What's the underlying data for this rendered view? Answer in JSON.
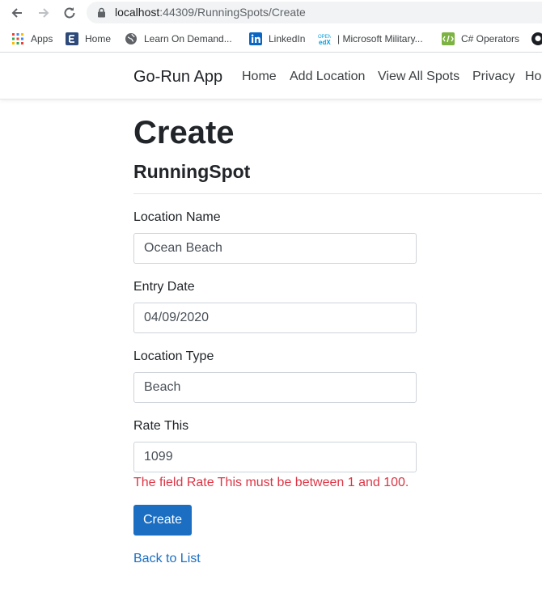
{
  "browser": {
    "url_host": "localhost",
    "url_rest": ":44309/RunningSpots/Create",
    "bookmarks": [
      {
        "label": "Apps",
        "icon": "apps-grid-icon"
      },
      {
        "label": "Home",
        "icon": "e-icon"
      },
      {
        "label": "Learn On Demand...",
        "icon": "globe-icon"
      },
      {
        "label": "LinkedIn",
        "icon": "linkedin-icon"
      },
      {
        "label": "| Microsoft Military...",
        "icon": "edx-icon"
      },
      {
        "label": "C# Operators",
        "icon": "code-icon"
      }
    ]
  },
  "nav": {
    "brand": "Go-Run App",
    "links": [
      "Home",
      "Add Location",
      "View All Spots",
      "Privacy",
      "Ho"
    ]
  },
  "page": {
    "title": "Create",
    "subtitle": "RunningSpot"
  },
  "form": {
    "location_name": {
      "label": "Location Name",
      "value": "Ocean Beach"
    },
    "entry_date": {
      "label": "Entry Date",
      "value": "04/09/2020"
    },
    "location_type": {
      "label": "Location Type",
      "value": "Beach"
    },
    "rate": {
      "label": "Rate This",
      "value": "1099",
      "error": "The field Rate This must be between 1 and 100."
    },
    "submit_label": "Create",
    "back_link": "Back to List"
  },
  "colors": {
    "primary": "#1b6ec2",
    "error": "#dc3545"
  }
}
